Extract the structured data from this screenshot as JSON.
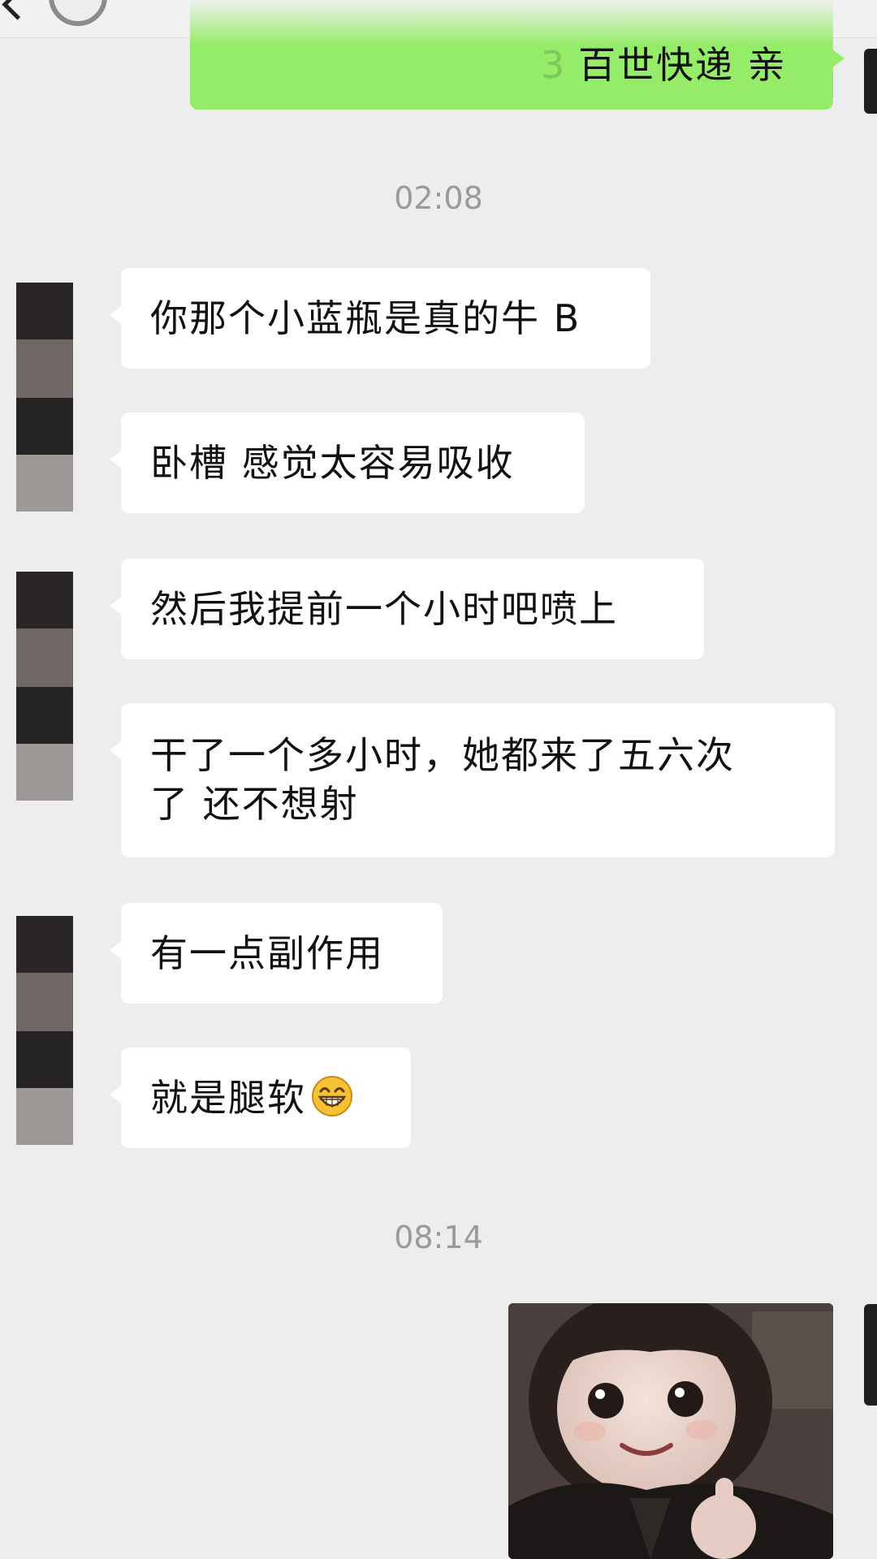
{
  "chat": {
    "outgoing_top": {
      "ghost_char": "3",
      "text": "百世快递 亲"
    },
    "timestamps": [
      "02:08",
      "08:14"
    ],
    "incoming": [
      {
        "text": "你那个小蓝瓶是真的牛 B"
      },
      {
        "text": "卧槽 感觉太容易吸收"
      },
      {
        "text": "然后我提前一个小时吧喷上"
      },
      {
        "text_line1": "干了一个多小时，她都来了五六次",
        "text_line2": "了 还不想射"
      },
      {
        "text": "有一点副作用"
      },
      {
        "text": "就是腿软",
        "emoji": "grinning-face-emoji"
      }
    ],
    "outgoing_photo": {
      "subject": "child-thumbs-up-sticker"
    }
  },
  "colors": {
    "background": "#ededed",
    "outgoing_bubble": "#95ec69",
    "incoming_bubble": "#ffffff",
    "timestamp_text": "#9a9a9a"
  }
}
